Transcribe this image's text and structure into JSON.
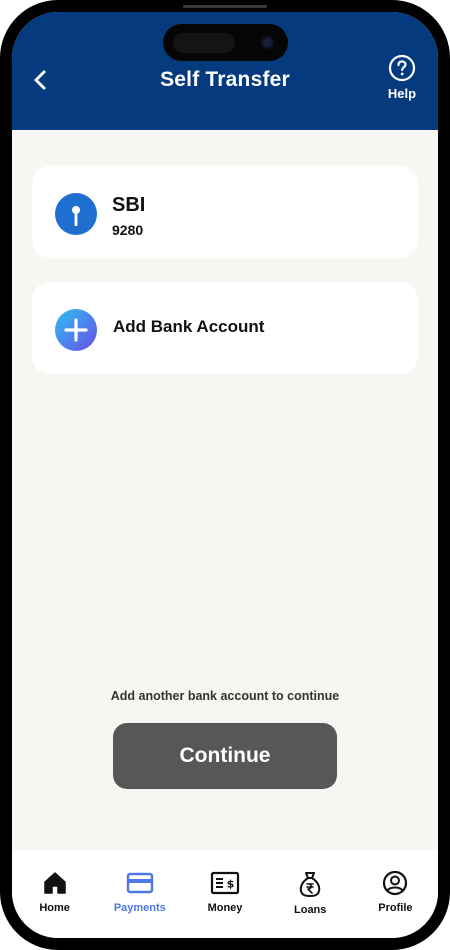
{
  "header": {
    "title": "Self Transfer",
    "help_label": "Help",
    "background": "#063a7f"
  },
  "accounts": [
    {
      "name": "SBI",
      "number": "9280",
      "icon": "sbi-logo"
    }
  ],
  "add_account": {
    "label": "Add Bank Account",
    "icon": "plus-circle-icon"
  },
  "footer": {
    "hint": "Add another bank account to continue",
    "continue_label": "Continue",
    "continue_color": "#575757"
  },
  "nav": {
    "active": "Payments",
    "accent": "#4f78e6",
    "items": [
      {
        "label": "Home",
        "icon": "home-icon"
      },
      {
        "label": "Payments",
        "icon": "card-icon"
      },
      {
        "label": "Money",
        "icon": "money-icon"
      },
      {
        "label": "Loans",
        "icon": "loan-bag-icon"
      },
      {
        "label": "Profile",
        "icon": "profile-icon"
      }
    ]
  }
}
